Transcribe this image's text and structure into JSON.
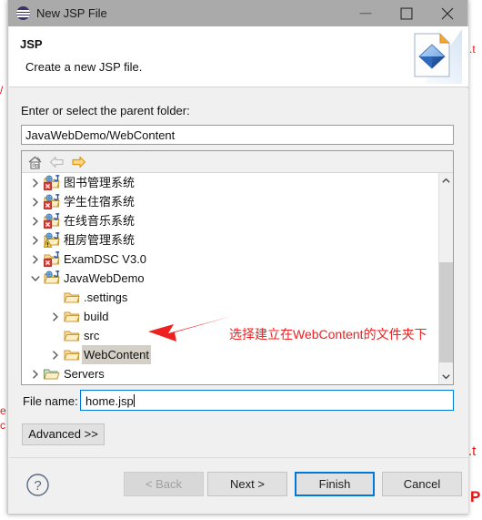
{
  "window": {
    "title": "New JSP File",
    "app_icon": "eclipse-icon",
    "controls": {
      "minimize": "minimize-icon",
      "maximize": "maximize-icon",
      "close": "close-icon"
    }
  },
  "header": {
    "title": "JSP",
    "description": "Create a new JSP file.",
    "icon": "jsp-file-banner-icon"
  },
  "parent_folder": {
    "label": "Enter or select the parent folder:",
    "value": "JavaWebDemo/WebContent",
    "placeholder": ""
  },
  "tree_toolbar": {
    "home": "home-icon",
    "back": "back-arrow-icon",
    "forward": "forward-arrow-icon"
  },
  "tree": {
    "items": [
      {
        "label": "图书管理系统",
        "icon": "java-web-project-error-icon",
        "indent": 0,
        "twisty": "collapsed",
        "selected": false
      },
      {
        "label": "学生住宿系统",
        "icon": "java-web-project-error-icon",
        "indent": 0,
        "twisty": "collapsed",
        "selected": false
      },
      {
        "label": "在线音乐系统",
        "icon": "java-web-project-error-icon",
        "indent": 0,
        "twisty": "collapsed",
        "selected": false
      },
      {
        "label": "租房管理系统",
        "icon": "java-web-project-warning-icon",
        "indent": 0,
        "twisty": "collapsed",
        "selected": false
      },
      {
        "label": "ExamDSC V3.0",
        "icon": "java-project-error-icon",
        "indent": 0,
        "twisty": "collapsed",
        "selected": false
      },
      {
        "label": "JavaWebDemo",
        "icon": "java-web-project-icon",
        "indent": 0,
        "twisty": "expanded",
        "selected": false
      },
      {
        "label": ".settings",
        "icon": "folder-icon",
        "indent": 1,
        "twisty": "none",
        "selected": false
      },
      {
        "label": "build",
        "icon": "folder-icon",
        "indent": 1,
        "twisty": "collapsed",
        "selected": false
      },
      {
        "label": "src",
        "icon": "folder-icon",
        "indent": 1,
        "twisty": "none",
        "selected": false
      },
      {
        "label": "WebContent",
        "icon": "folder-icon",
        "indent": 1,
        "twisty": "collapsed",
        "selected": true
      },
      {
        "label": "Servers",
        "icon": "server-folder-icon",
        "indent": 0,
        "twisty": "collapsed",
        "selected": false
      }
    ],
    "scrollbar": {
      "up": "scroll-up-icon",
      "down": "scroll-down-icon"
    }
  },
  "file_name": {
    "label": "File name:",
    "value": "home.jsp",
    "placeholder": ""
  },
  "advanced": {
    "label": "Advanced >>"
  },
  "footer": {
    "help": "help-icon",
    "back": "< Back",
    "next": "Next >",
    "finish": "Finish",
    "cancel": "Cancel"
  },
  "annotation": {
    "text": "选择建立在WebContent的文件夹下",
    "arrow": "red-arrow-left-icon",
    "color": "#ef2020"
  },
  "background_fragments": {
    "right": [
      ".t",
      "P"
    ],
    "left": [
      "e",
      "c",
      "/"
    ]
  },
  "colors": {
    "titlebar": "#aaaaaa",
    "dialog_bg": "#f0f0f0",
    "accent": "#0078d7",
    "annotation_red": "#ef2020",
    "selection": "#d4d0c8"
  }
}
